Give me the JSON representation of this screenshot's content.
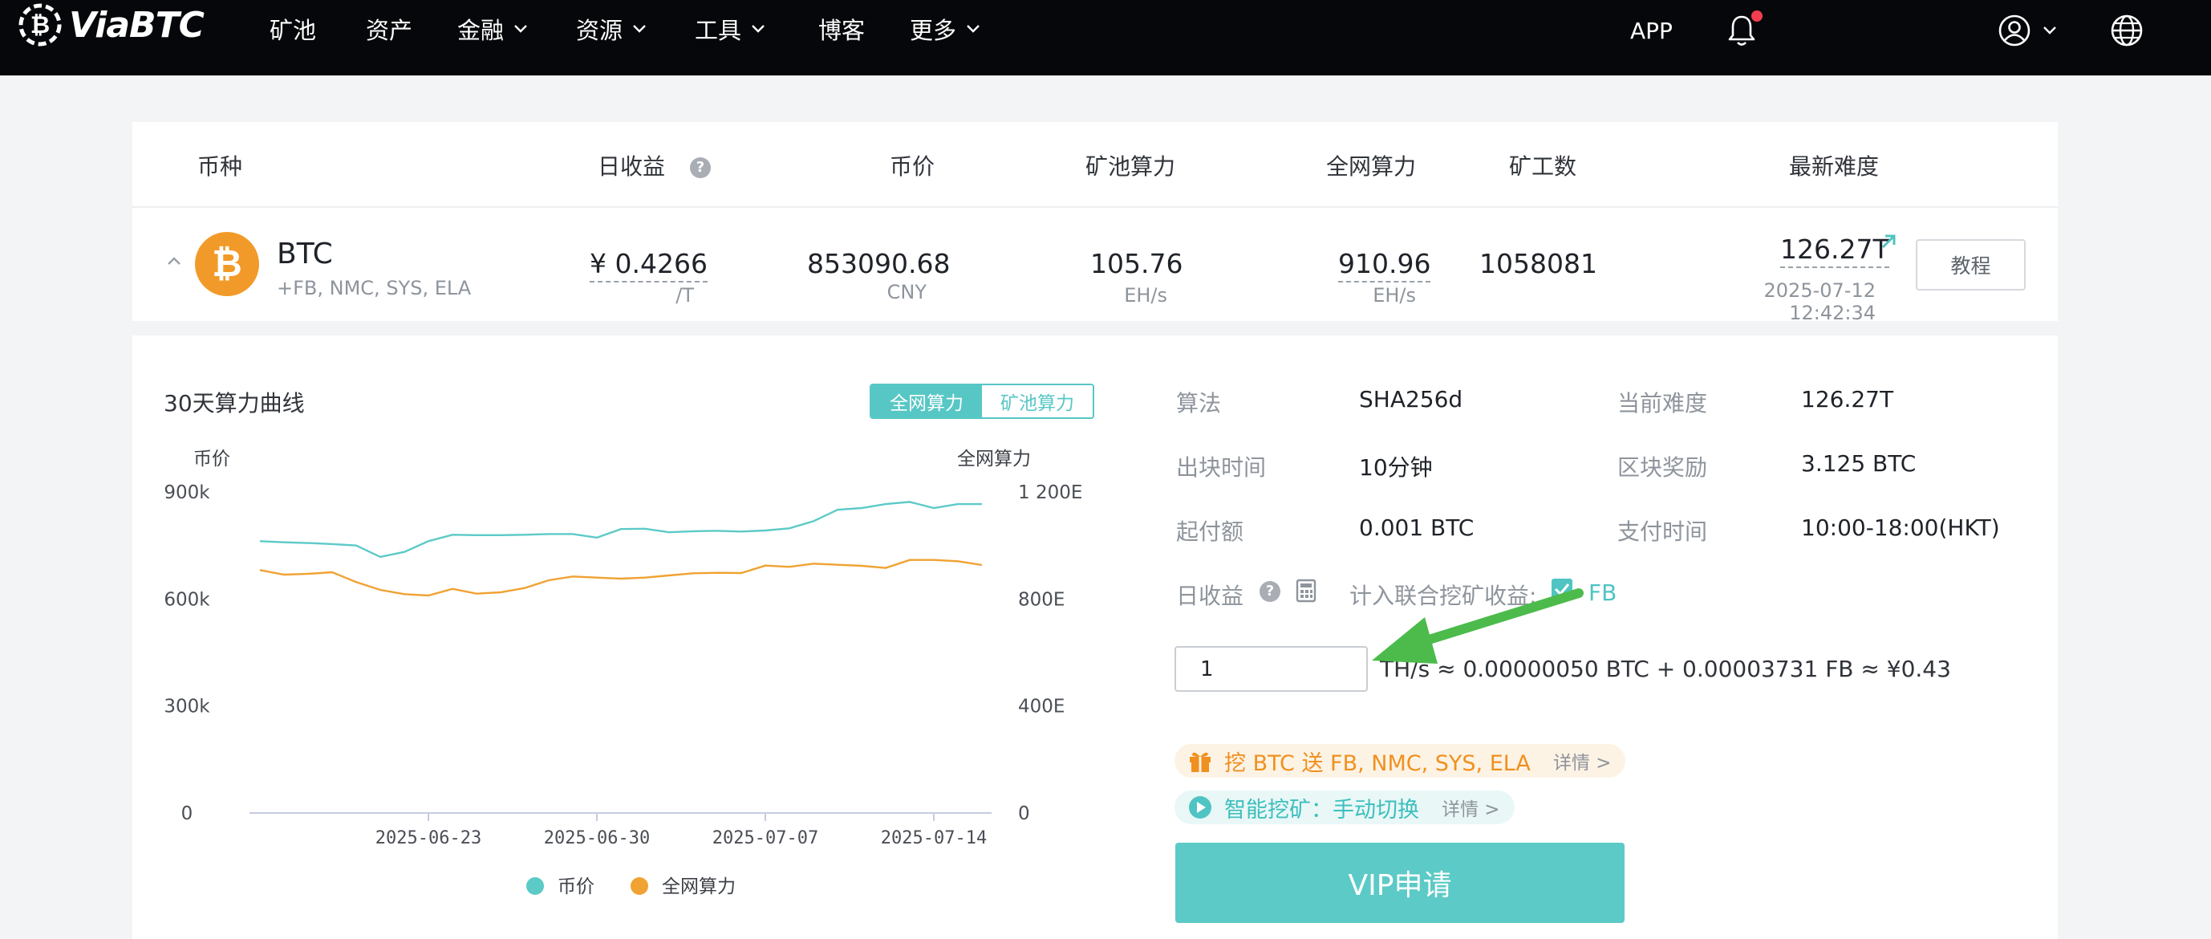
{
  "nav": {
    "logo": "ViaBTC",
    "items": [
      {
        "label": "矿池",
        "has_dropdown": false
      },
      {
        "label": "资产",
        "has_dropdown": false
      },
      {
        "label": "金融",
        "has_dropdown": true
      },
      {
        "label": "资源",
        "has_dropdown": true
      },
      {
        "label": "工具",
        "has_dropdown": true
      },
      {
        "label": "博客",
        "has_dropdown": false
      },
      {
        "label": "更多",
        "has_dropdown": true
      }
    ],
    "app": "APP"
  },
  "table": {
    "headers": {
      "coin": "币种",
      "daily_income": "日收益",
      "price": "币价",
      "pool_hashrate": "矿池算力",
      "network_hashrate": "全网算力",
      "miners": "矿工数",
      "difficulty": "最新难度"
    },
    "row": {
      "coin": "BTC",
      "merged": "+FB, NMC, SYS, ELA",
      "daily_income": "¥ 0.4266",
      "daily_income_unit": "/T",
      "price": "853090.68",
      "price_unit": "CNY",
      "pool_hashrate": "105.76",
      "pool_hashrate_unit": "EH/s",
      "network_hashrate": "910.96",
      "network_hashrate_unit": "EH/s",
      "miners": "1058081",
      "difficulty": "126.27T",
      "difficulty_time": "2025-07-12 12:42:34",
      "tutorial": "教程"
    }
  },
  "chart_panel": {
    "title": "30天算力曲线",
    "toggle_network": "全网算力",
    "toggle_pool": "矿池算力",
    "left_axis_title": "币价",
    "right_axis_title": "全网算力"
  },
  "chart_data": {
    "type": "line",
    "x_ticks": [
      "2025-06-23",
      "2025-06-30",
      "2025-07-07",
      "2025-07-14"
    ],
    "left_ticks": [
      "900k",
      "600k",
      "300k",
      "0"
    ],
    "right_ticks": [
      "1 200E",
      "800E",
      "400E",
      "0"
    ],
    "ylim_left": [
      0,
      900000
    ],
    "ylim_right": [
      0,
      1200
    ],
    "legend": [
      "币价",
      "全网算力"
    ],
    "colors": {
      "price": "#5ccac7",
      "hashrate": "#f0a232"
    },
    "series": [
      {
        "name": "币价",
        "axis": "left",
        "values": [
          762000,
          759000,
          757000,
          754000,
          750000,
          718000,
          732000,
          762000,
          780000,
          779000,
          779000,
          780000,
          782000,
          782000,
          772000,
          796000,
          797000,
          787000,
          790000,
          791000,
          789000,
          792000,
          798000,
          818000,
          850000,
          855000,
          866000,
          872000,
          855000,
          866000,
          866000
        ]
      },
      {
        "name": "全网算力",
        "axis": "right",
        "values": [
          908,
          891,
          894,
          900,
          863,
          834,
          818,
          813,
          838,
          820,
          825,
          841,
          870,
          884,
          880,
          876,
          880,
          888,
          896,
          898,
          897,
          925,
          920,
          932,
          928,
          924,
          916,
          946,
          946,
          941,
          927
        ]
      }
    ]
  },
  "details": {
    "algorithm_label": "算法",
    "algorithm": "SHA256d",
    "difficulty_label": "当前难度",
    "difficulty": "126.27T",
    "block_time_label": "出块时间",
    "block_time": "10分钟",
    "reward_label": "区块奖励",
    "reward": "3.125 BTC",
    "min_payout_label": "起付额",
    "min_payout": "0.001 BTC",
    "pay_time_label": "支付时间",
    "pay_time": "10:00-18:00(HKT)",
    "daily_label": "日收益",
    "merged_label": "计入联合挖矿收益:",
    "merged_coin": "FB",
    "calc_value": "1",
    "calc_result": "TH/s ≈ 0.00000050 BTC + 0.00003731 FB ≈ ¥0.43",
    "promo1": "挖 BTC 送 FB, NMC, SYS, ELA",
    "promo1_more": "详情 >",
    "promo2": "智能挖矿：手动切换",
    "promo2_more": "详情 >",
    "vip": "VIP申请"
  }
}
